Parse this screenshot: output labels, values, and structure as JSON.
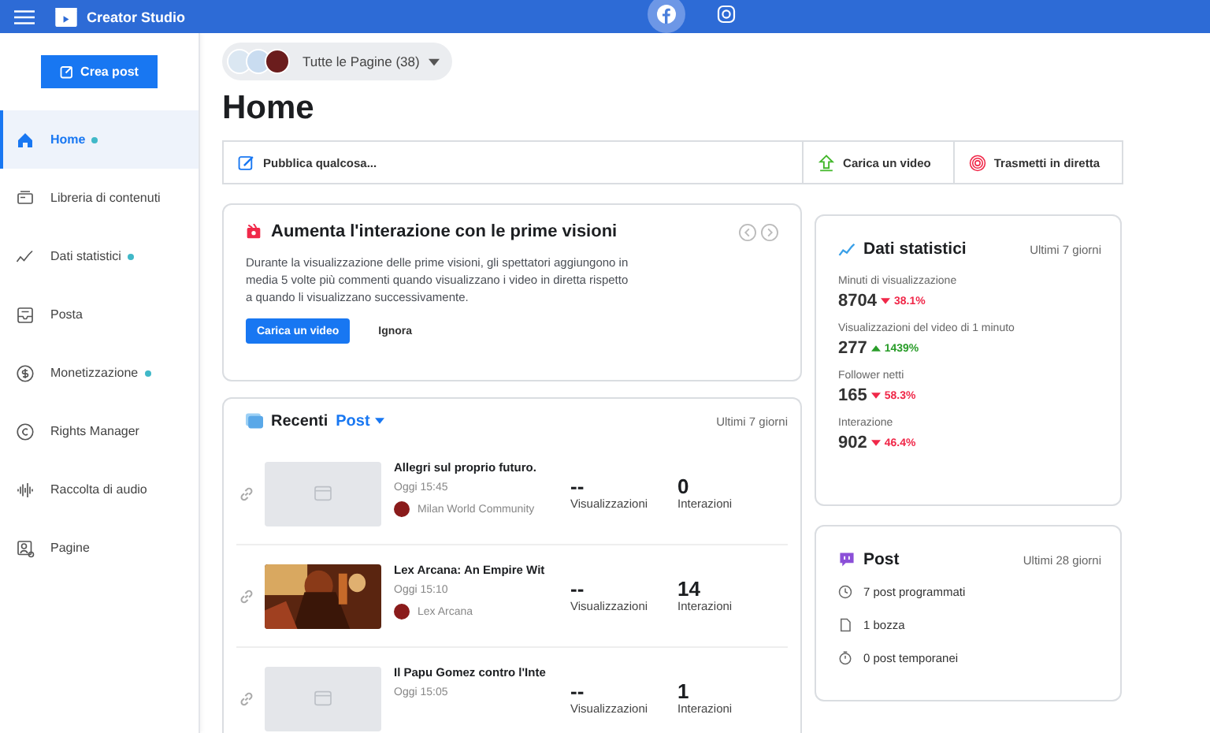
{
  "topbar": {
    "title": "Creator Studio",
    "platforms": [
      {
        "kind": "facebook",
        "selected": true
      },
      {
        "kind": "instagram",
        "selected": false
      }
    ]
  },
  "create_button": "Crea post",
  "sidebar": {
    "items": [
      {
        "label": "Home",
        "kind": "home",
        "selected": true,
        "dot": true
      },
      {
        "label": "Libreria di contenuti",
        "kind": "library",
        "selected": false,
        "dot": false
      },
      {
        "label": "Dati statistici",
        "kind": "stats",
        "selected": false,
        "dot": true
      },
      {
        "label": "Posta",
        "kind": "inbox",
        "selected": false,
        "dot": false
      },
      {
        "label": "Monetizzazione",
        "kind": "money",
        "selected": false,
        "dot": true
      },
      {
        "label": "Rights Manager",
        "kind": "rights",
        "selected": false,
        "dot": false
      },
      {
        "label": "Raccolta di audio",
        "kind": "audio",
        "selected": false,
        "dot": false
      },
      {
        "label": "Pagine",
        "kind": "pages",
        "selected": false,
        "dot": false
      }
    ]
  },
  "page_selector": "Tutte le Pagine (38)",
  "heading": "Home",
  "actions": [
    {
      "label": "Pubblica qualcosa...",
      "kind": "publish"
    },
    {
      "label": "Carica un video",
      "kind": "upload"
    },
    {
      "label": "Trasmetti in diretta",
      "kind": "live"
    }
  ],
  "tip_card": {
    "title": "Aumenta l'interazione con le prime visioni",
    "text": "Durante la visualizzazione delle prime visioni, gli spettatori aggiungono in media 5 volte più commenti quando visualizzano i video in diretta rispetto a quando li visualizzano successivamente.",
    "primary": "Carica un video",
    "secondary": "Ignora"
  },
  "recent": {
    "title": "Recenti",
    "filter": "Post",
    "period": "Ultimi 7 giorni",
    "rows": [
      {
        "title": "Allegri sul proprio futuro.",
        "time": "Oggi 15:45",
        "page": "Milan World Community",
        "kind": "placeholder",
        "views": "--",
        "views_label": "Visualizzazioni",
        "interactions": "0",
        "interactions_label": "Interazioni"
      },
      {
        "title": "Lex Arcana: An Empire Wit",
        "time": "Oggi 15:10",
        "page": "Lex Arcana",
        "kind": "picture",
        "views": "--",
        "views_label": "Visualizzazioni",
        "interactions": "14",
        "interactions_label": "Interazioni"
      },
      {
        "title": "Il Papu Gomez contro l'Inte",
        "time": "Oggi 15:05",
        "kind": "placeholder",
        "views": "--",
        "views_label": "Visualizzazioni",
        "interactions": "1",
        "interactions_label": "Interazioni"
      }
    ]
  },
  "stats": {
    "title": "Dati statistici",
    "period": "Ultimi 7 giorni",
    "items": [
      {
        "label": "Minuti di visualizzazione",
        "value": "8704",
        "change": "38.1%",
        "kind": "down"
      },
      {
        "label": "Visualizzazioni del video di 1 minuto",
        "value": "277",
        "change": "1439%",
        "kind": "up"
      },
      {
        "label": "Follower netti",
        "value": "165",
        "change": "58.3%",
        "kind": "down"
      },
      {
        "label": "Interazione",
        "value": "902",
        "change": "46.4%",
        "kind": "down"
      }
    ]
  },
  "posts": {
    "title": "Post",
    "period": "Ultimi 28 giorni",
    "items": [
      {
        "label": "7 post programmati",
        "kind": "clock"
      },
      {
        "label": "1 bozza",
        "kind": "doc"
      },
      {
        "label": "0 post temporanei",
        "kind": "timer"
      }
    ]
  }
}
